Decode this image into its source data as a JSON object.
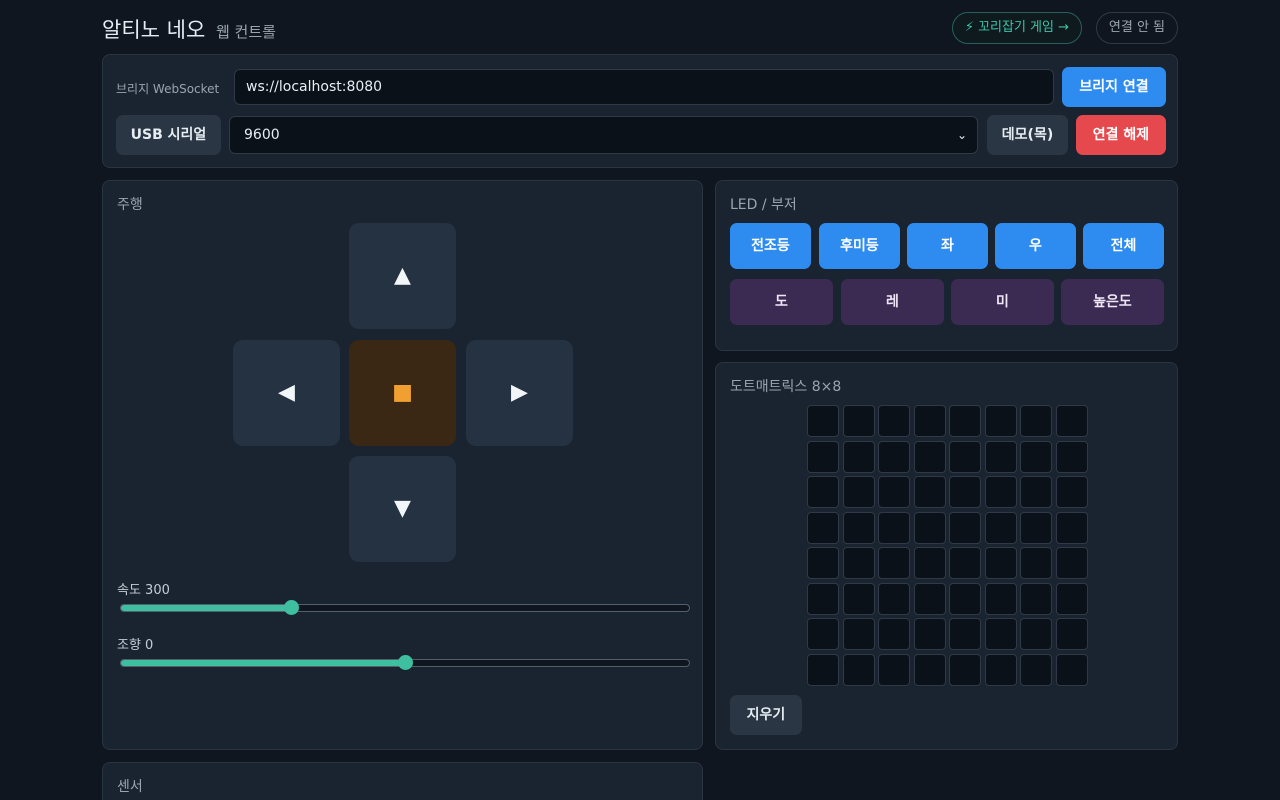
{
  "header": {
    "title": "알티노 네오",
    "subtitle": "웹 컨트롤",
    "game_link": "⚡ 꼬리잡기 게임 →",
    "status": "연결 안 됨"
  },
  "connection": {
    "bridge_label": "브리지 WebSocket",
    "ws_url": "ws://localhost:8080",
    "bridge_button": "브리지 연결",
    "usb_button": "USB 시리얼",
    "baud_rate": "9600",
    "demo_button": "데모(목)",
    "disconnect_button": "연결 해제"
  },
  "drive": {
    "title": "주행",
    "pad": {
      "up": "▲",
      "left": "◀",
      "stop": "■",
      "right": "▶",
      "down": "▼"
    },
    "speed_label": "속도 300",
    "speed_fraction": 0.3,
    "steer_label": "조향 0",
    "steer_fraction": 0.5
  },
  "led": {
    "title": "LED / 부저",
    "lights": [
      "전조등",
      "후미등",
      "좌",
      "우",
      "전체"
    ],
    "tones": [
      "도",
      "레",
      "미",
      "높은도"
    ]
  },
  "matrix": {
    "title": "도트매트릭스 8×8",
    "rows": 8,
    "cols": 8,
    "clear_button": "지우기"
  },
  "sensor": {
    "title": "센서"
  },
  "colors": {
    "accent_blue": "#2e8cf0",
    "accent_red": "#e5484d",
    "accent_teal": "#3dbfa0",
    "stop_orange": "#f0a030",
    "tone_purple": "#3b2a52"
  }
}
